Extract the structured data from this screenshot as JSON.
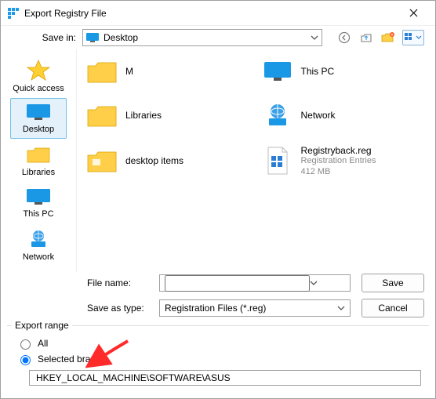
{
  "window": {
    "title": "Export Registry File"
  },
  "top": {
    "save_in_label": "Save in:",
    "location": "Desktop"
  },
  "places": [
    {
      "id": "quick-access",
      "label": "Quick access"
    },
    {
      "id": "desktop",
      "label": "Desktop"
    },
    {
      "id": "libraries",
      "label": "Libraries"
    },
    {
      "id": "this-pc",
      "label": "This PC"
    },
    {
      "id": "network",
      "label": "Network"
    }
  ],
  "places_selected_index": 1,
  "files": [
    {
      "icon": "folder",
      "name": "M"
    },
    {
      "icon": "thispc",
      "name": "This PC"
    },
    {
      "icon": "folder",
      "name": "Libraries"
    },
    {
      "icon": "network",
      "name": "Network"
    },
    {
      "icon": "folder",
      "name": "desktop items"
    },
    {
      "icon": "regfile",
      "name": "Registryback.reg",
      "sub1": "Registration Entries",
      "sub2": "412 MB"
    }
  ],
  "fields": {
    "file_name_label": "File name:",
    "file_name_value": "",
    "save_as_type_label": "Save as type:",
    "save_as_type_value": "Registration Files (*.reg)"
  },
  "buttons": {
    "save": "Save",
    "cancel": "Cancel"
  },
  "export_range": {
    "legend": "Export range",
    "all_label": "All",
    "selected_label": "Selected branch",
    "selected": "selected",
    "branch_value": "HKEY_LOCAL_MACHINE\\SOFTWARE\\ASUS"
  }
}
